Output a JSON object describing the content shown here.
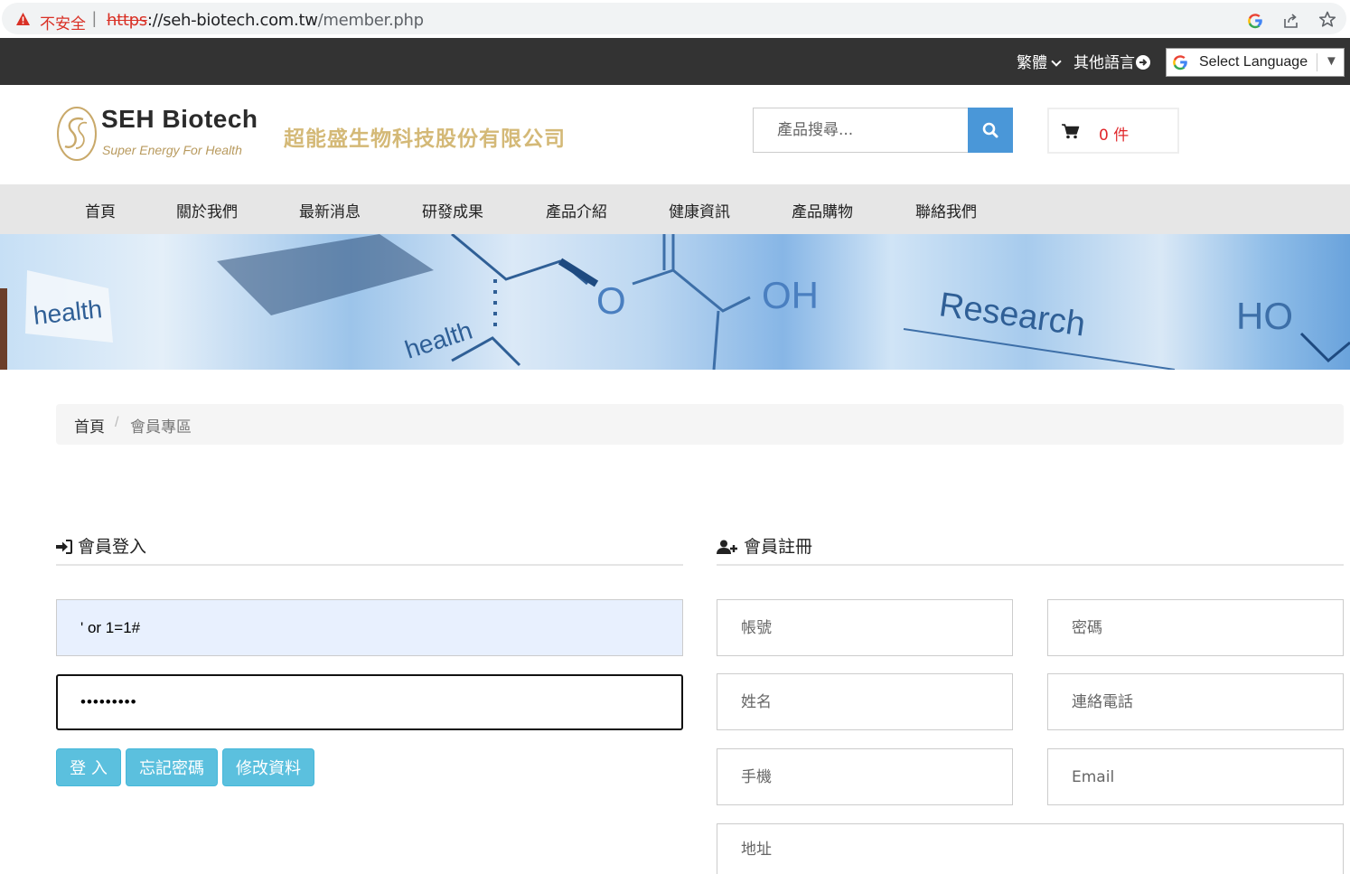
{
  "browser": {
    "security_label": "不安全",
    "separator": "|",
    "url_scheme": "https",
    "url_host": "://seh-biotech.com.tw",
    "url_path": "/member.php"
  },
  "topbar": {
    "lang_current": "繁體",
    "lang_other": "其他語言",
    "translate_label": "Select Language",
    "translate_arrow": "▼"
  },
  "header": {
    "brand_name": "SEH Biotech",
    "brand_tagline": "Super Energy For Health",
    "company_name": "超能盛生物科技股份有限公司",
    "search_placeholder": "產品搜尋...",
    "cart_count": "0 件"
  },
  "nav": {
    "items": [
      "首頁",
      "關於我們",
      "最新消息",
      "研發成果",
      "產品介紹",
      "健康資訊",
      "產品購物",
      "聯絡我們"
    ]
  },
  "banner": {
    "words": [
      "health",
      "health",
      "O",
      "OH",
      "Research",
      "HO"
    ]
  },
  "breadcrumb": {
    "home": "首頁",
    "separator": "/",
    "current": "會員專區"
  },
  "login": {
    "title": "會員登入",
    "username_value": "' or 1=1#",
    "password_value": "•••••••••",
    "buttons": {
      "login": "登 入",
      "forgot": "忘記密碼",
      "edit": "修改資料"
    }
  },
  "register": {
    "title": "會員註冊",
    "placeholders": {
      "account": "帳號",
      "password": "密碼",
      "name": "姓名",
      "phone": "連絡電話",
      "mobile": "手機",
      "email": "Email",
      "address": "地址"
    }
  },
  "colors": {
    "topbar_bg": "#333333",
    "nav_bg": "#e6e6e6",
    "search_button": "#4a97d8",
    "action_button": "#5bc0de",
    "cart_count": "#e0272b",
    "company_gold": "#d4b977",
    "autofill_bg": "#e8f0fe"
  }
}
